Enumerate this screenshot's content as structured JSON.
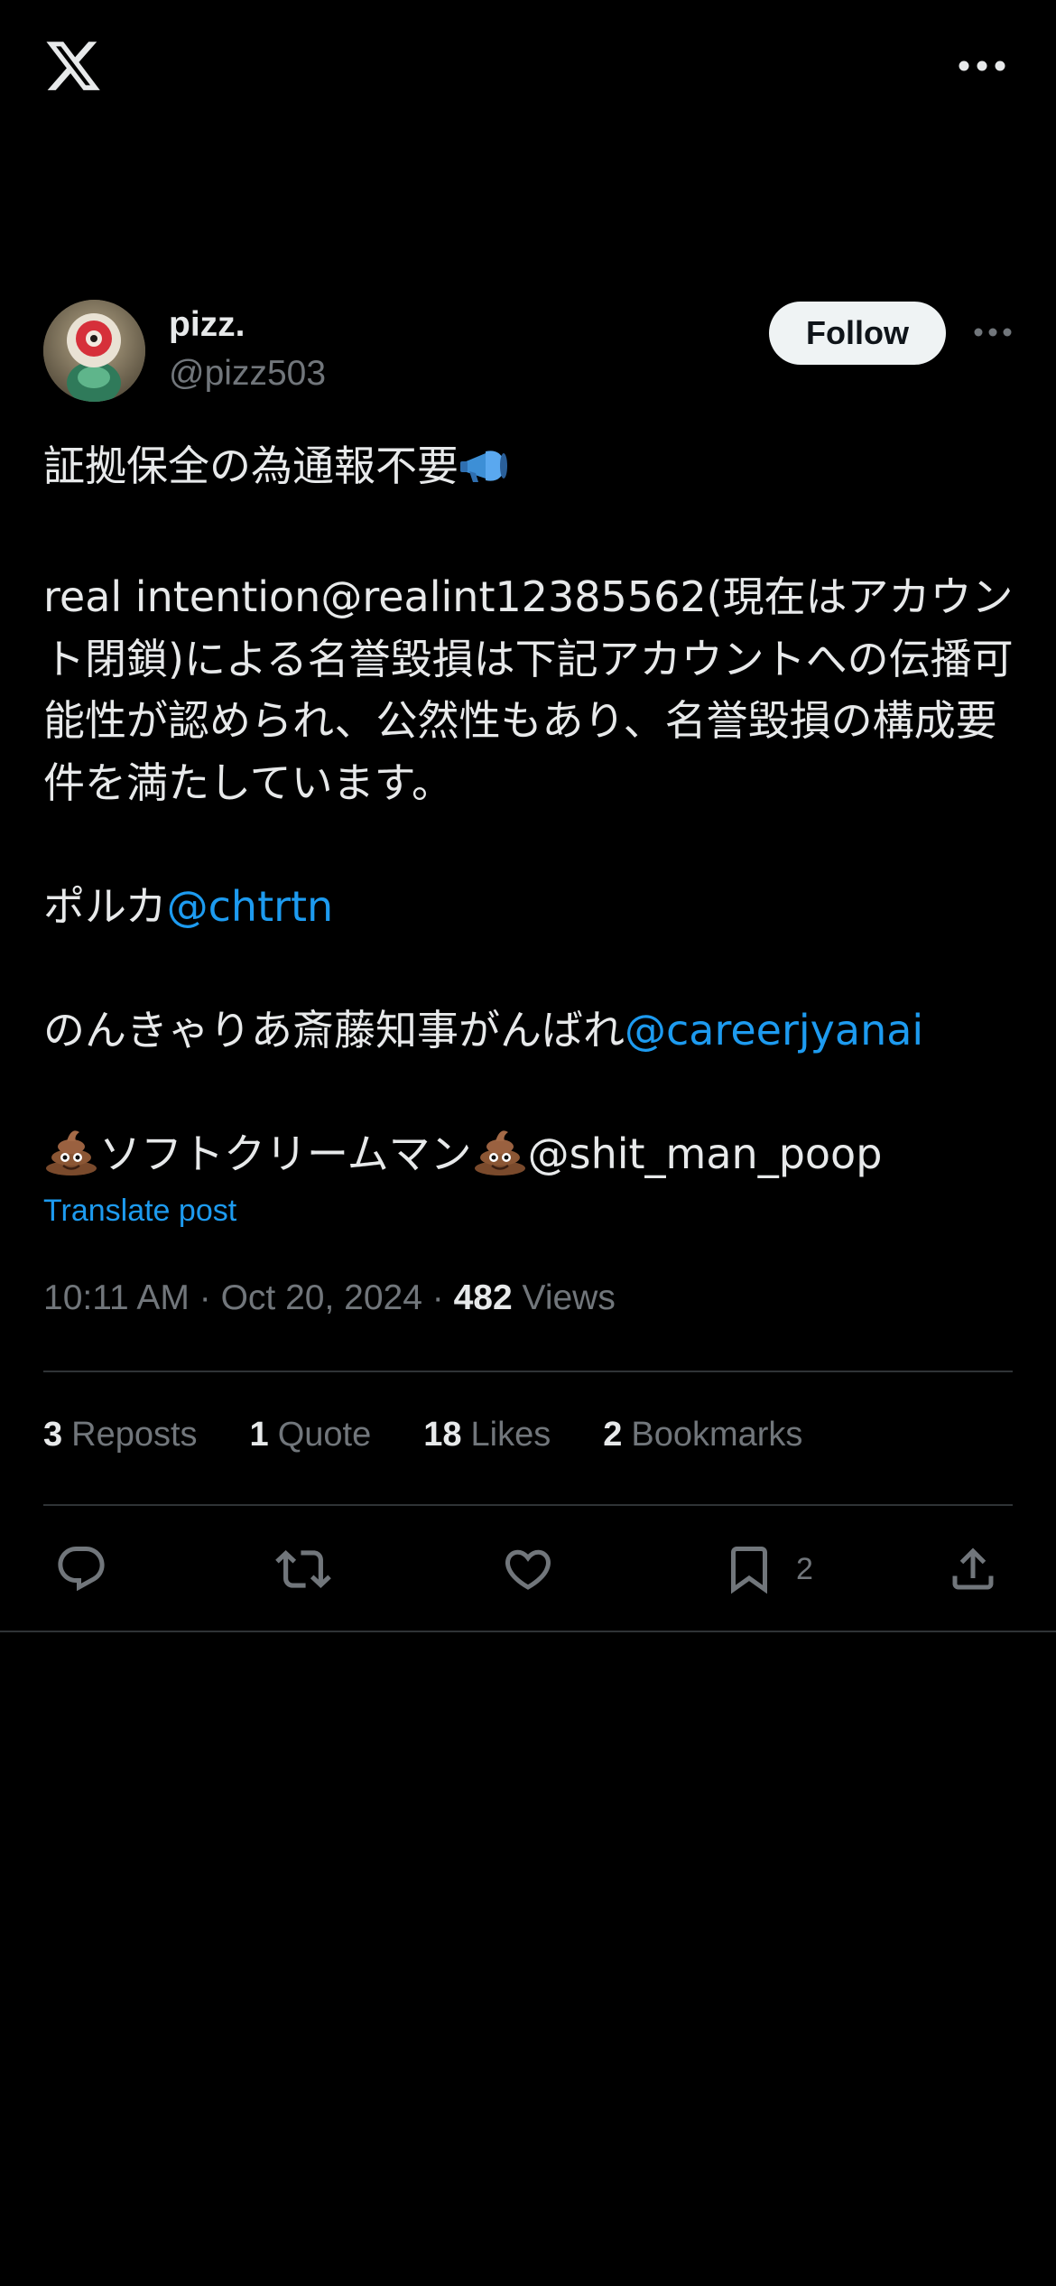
{
  "header": {
    "logo_icon": "x-logo-icon",
    "more_icon": "more-horizontal-icon"
  },
  "author": {
    "display_name": "pizz.",
    "handle": "@pizz503",
    "follow_label": "Follow",
    "more_icon": "more-horizontal-icon"
  },
  "post": {
    "line1_text": "証拠保全の為通報不要",
    "line1_emoji": "megaphone-emoji",
    "paragraph2": "real intention@realint12385562(現在はアカウント閉鎖)による名誉毀損は下記アカウントへの伝播可能性が認められ、公然性もあり、名誉毀損の構成要件を満たしています。",
    "paragraph3_prefix": "ポルカ",
    "paragraph3_mention": "@chtrtn",
    "paragraph4_prefix": "のんきゃりあ斎藤知事がんばれ",
    "paragraph4_mention": "@careerjyanai",
    "paragraph5_name": "ソフトクリームマン",
    "paragraph5_handle": "@shit_man_poop",
    "paragraph5_emoji": "pile-of-poo-emoji",
    "translate_label": "Translate post"
  },
  "meta": {
    "time": "10:11 AM",
    "separator": "·",
    "date": "Oct 20, 2024",
    "views_count": "482",
    "views_label": "Views"
  },
  "stats": {
    "reposts_count": "3",
    "reposts_label": "Reposts",
    "quotes_count": "1",
    "quotes_label": "Quote",
    "likes_count": "18",
    "likes_label": "Likes",
    "bookmarks_count": "2",
    "bookmarks_label": "Bookmarks"
  },
  "actions": {
    "reply_icon": "reply-icon",
    "repost_icon": "repost-icon",
    "like_icon": "heart-icon",
    "bookmark_icon": "bookmark-icon",
    "bookmark_count": "2",
    "share_icon": "share-icon"
  },
  "colors": {
    "background": "#000000",
    "text": "#e7e9ea",
    "secondary": "#71767b",
    "link": "#1d9bf0",
    "divider": "#2f3336"
  }
}
